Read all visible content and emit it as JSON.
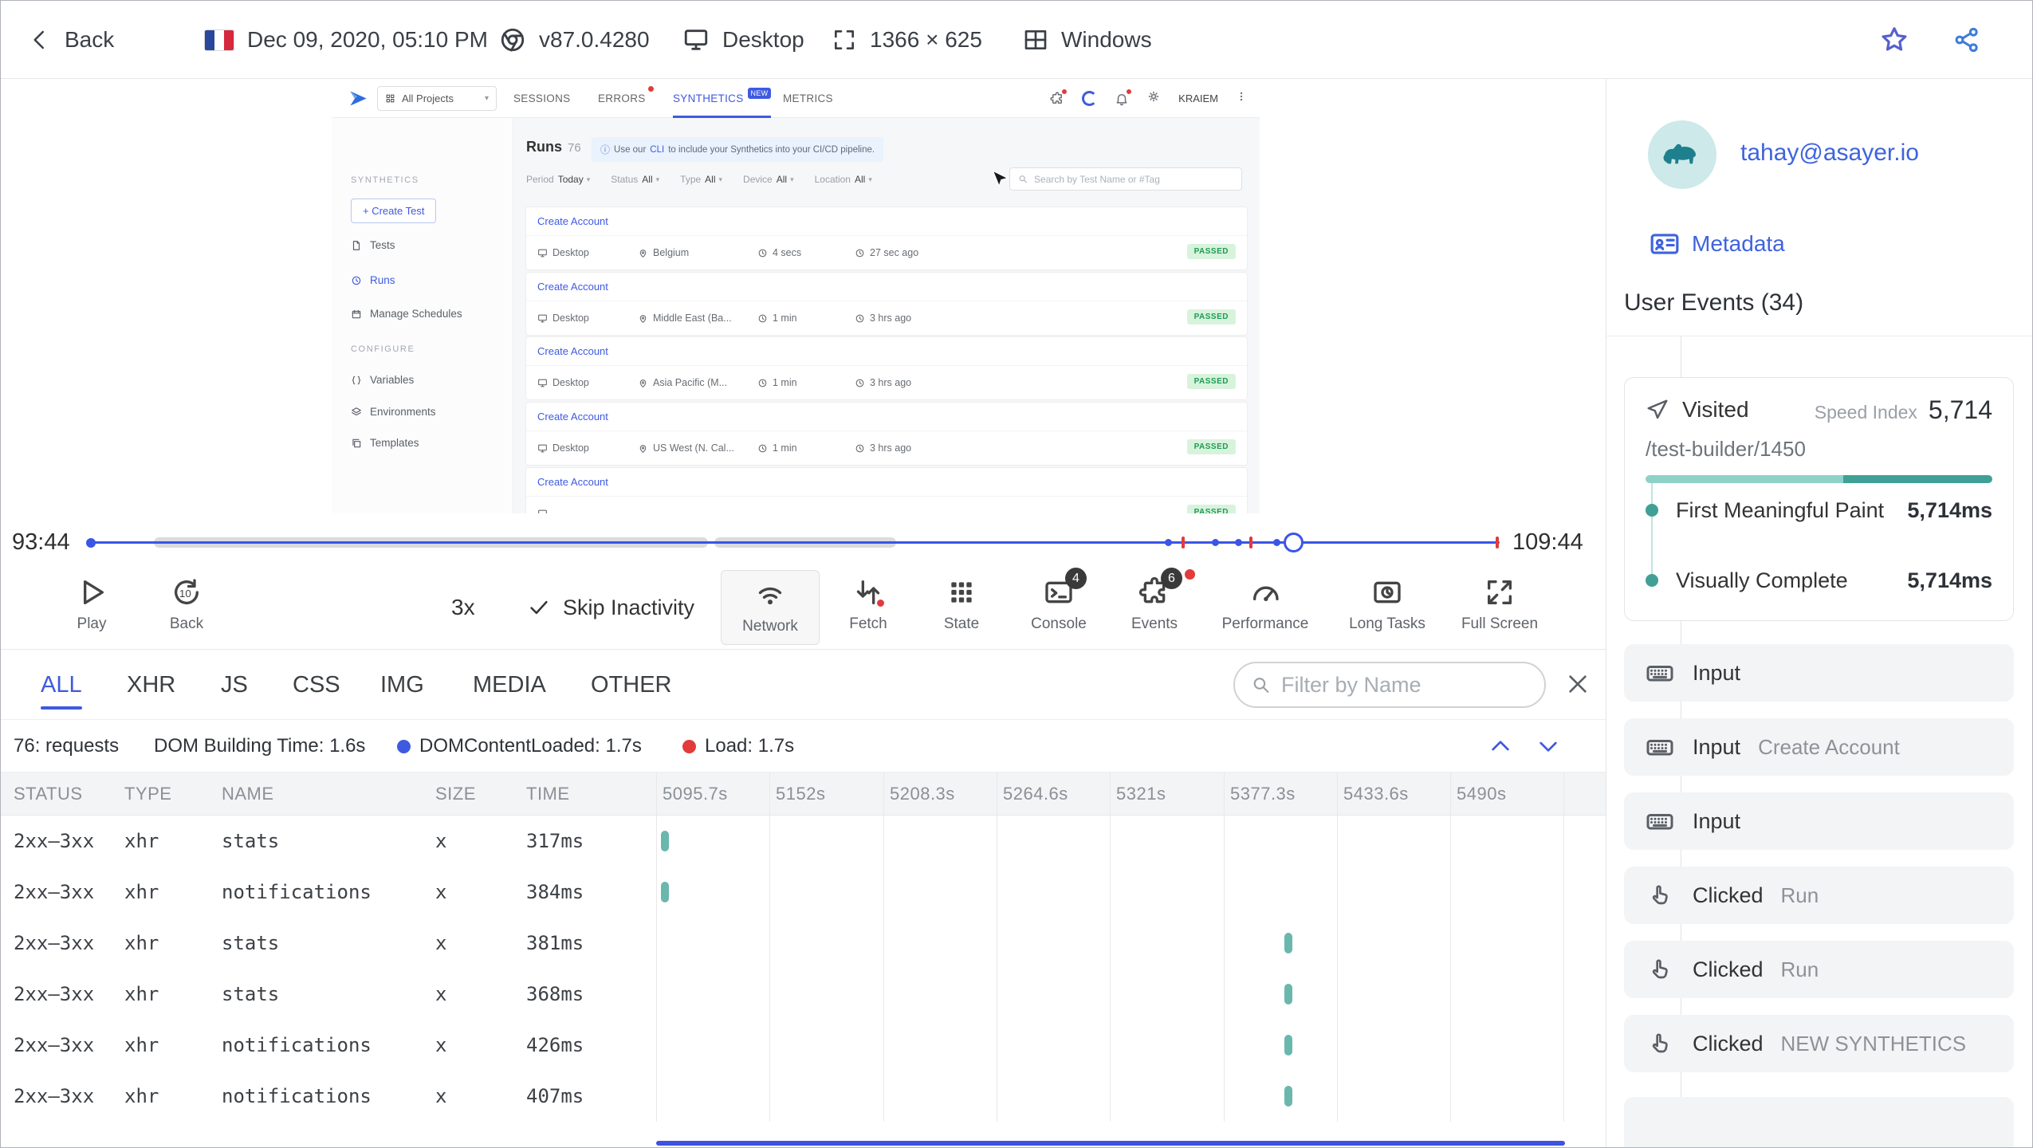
{
  "header": {
    "back_label": "Back",
    "date": "Dec 09, 2020, 05:10 PM",
    "browser_version": "v87.0.4280",
    "device": "Desktop",
    "resolution": "1366 × 625",
    "os": "Windows"
  },
  "replay_app": {
    "nav": {
      "project_selector": "All Projects",
      "tab_sessions": "SESSIONS",
      "tab_errors": "ERRORS",
      "tab_synthetics": "SYNTHETICS",
      "new_badge": "NEW",
      "tab_metrics": "METRICS",
      "user_name": "KRAIEM"
    },
    "sidebar": {
      "section_synthetics": "SYNTHETICS",
      "create_test": "+ Create Test",
      "tests": "Tests",
      "runs": "Runs",
      "manage_schedules": "Manage Schedules",
      "section_configure": "CONFIGURE",
      "variables": "Variables",
      "environments": "Environments",
      "templates": "Templates"
    },
    "main": {
      "title": "Runs",
      "count": "76",
      "banner_icon": "ⓘ",
      "banner_pre": "Use our",
      "banner_link": "CLI",
      "banner_post": "to include your Synthetics into your CI/CD pipeline.",
      "filters": [
        {
          "label": "Period",
          "value": "Today"
        },
        {
          "label": "Status",
          "value": "All"
        },
        {
          "label": "Type",
          "value": "All"
        },
        {
          "label": "Device",
          "value": "All"
        },
        {
          "label": "Location",
          "value": "All"
        }
      ],
      "search_placeholder": "Search by Test Name or #Tag",
      "runs": [
        {
          "name": "Create Account",
          "device": "Desktop",
          "location": "Belgium",
          "duration": "4 secs",
          "ago": "27 sec ago",
          "status": "PASSED"
        },
        {
          "name": "Create Account",
          "device": "Desktop",
          "location": "Middle East (Ba...",
          "duration": "1 min",
          "ago": "3 hrs ago",
          "status": "PASSED"
        },
        {
          "name": "Create Account",
          "device": "Desktop",
          "location": "Asia Pacific (M...",
          "duration": "1 min",
          "ago": "3 hrs ago",
          "status": "PASSED"
        },
        {
          "name": "Create Account",
          "device": "Desktop",
          "location": "US West (N. Cal...",
          "duration": "1 min",
          "ago": "3 hrs ago",
          "status": "PASSED"
        },
        {
          "name": "Create Account",
          "device": "",
          "location": "",
          "duration": "",
          "ago": "",
          "status": "PASSED"
        }
      ]
    }
  },
  "timeline": {
    "current": "93:44",
    "total": "109:44"
  },
  "controls": {
    "play": "Play",
    "back": "Back",
    "speed": "3x",
    "skip_inactivity": "Skip Inactivity",
    "network": "Network",
    "fetch": "Fetch",
    "state": "State",
    "console": "Console",
    "console_badge": "4",
    "events": "Events",
    "events_badge": "6",
    "performance": "Performance",
    "long_tasks": "Long Tasks",
    "full_screen": "Full Screen"
  },
  "network": {
    "tabs": [
      "ALL",
      "XHR",
      "JS",
      "CSS",
      "IMG",
      "MEDIA",
      "OTHER"
    ],
    "filter_placeholder": "Filter by Name",
    "requests": "76: requests",
    "dom_building": "DOM Building Time: 1.6s",
    "dom_content_loaded": "DOMContentLoaded: 1.7s",
    "load": "Load: 1.7s",
    "columns": {
      "status": "STATUS",
      "type": "TYPE",
      "name": "NAME",
      "size": "SIZE",
      "time": "TIME"
    },
    "time_columns": [
      "5095.7s",
      "5152s",
      "5208.3s",
      "5264.6s",
      "5321s",
      "5377.3s",
      "5433.6s",
      "5490s"
    ],
    "rows": [
      {
        "status": "2xx–3xx",
        "type": "xhr",
        "name": "stats",
        "size": "x",
        "time": "317ms"
      },
      {
        "status": "2xx–3xx",
        "type": "xhr",
        "name": "notifications",
        "size": "x",
        "time": "384ms"
      },
      {
        "status": "2xx–3xx",
        "type": "xhr",
        "name": "stats",
        "size": "x",
        "time": "381ms"
      },
      {
        "status": "2xx–3xx",
        "type": "xhr",
        "name": "stats",
        "size": "x",
        "time": "368ms"
      },
      {
        "status": "2xx–3xx",
        "type": "xhr",
        "name": "notifications",
        "size": "x",
        "time": "426ms"
      },
      {
        "status": "2xx–3xx",
        "type": "xhr",
        "name": "notifications",
        "size": "x",
        "time": "407ms"
      }
    ]
  },
  "user_panel": {
    "email": "tahay@asayer.io",
    "metadata_label": "Metadata",
    "events_title": "User Events (34)",
    "visited": {
      "label": "Visited",
      "speed_index_label": "Speed Index",
      "speed_index": "5,714",
      "path": "/test-builder/1450",
      "metrics": [
        {
          "name": "First Meaningful Paint",
          "value": "5,714ms"
        },
        {
          "name": "Visually Complete",
          "value": "5,714ms"
        }
      ]
    },
    "events": [
      {
        "type": "Input",
        "detail": ""
      },
      {
        "type": "Input",
        "detail": "Create Account"
      },
      {
        "type": "Input",
        "detail": ""
      },
      {
        "type": "Clicked",
        "detail": "Run"
      },
      {
        "type": "Clicked",
        "detail": "Run"
      },
      {
        "type": "Clicked",
        "detail": "NEW SYNTHETICS"
      }
    ]
  },
  "colors": {
    "accent_blue": "#3e5ae0",
    "teal": "#41a096",
    "passed_green": "#1f9a55",
    "error_red": "#e23b3b"
  }
}
